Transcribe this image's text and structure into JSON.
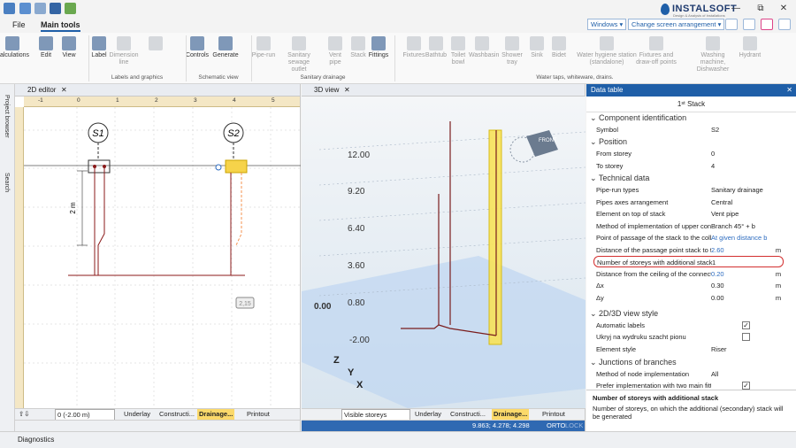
{
  "titlebar": {
    "brand": "INSTALSOFT",
    "brand_sub": "Design & Analysis of Installations",
    "min": "—",
    "restore": "⧉",
    "close": "✕"
  },
  "menu": {
    "file": "File",
    "main_tools": "Main tools",
    "windows": "Windows",
    "screen_arrangement": "Change screen arrangement"
  },
  "ribbon": {
    "buttons": [
      {
        "label": "Calculations",
        "dis": false
      },
      {
        "label": "Edit",
        "dis": false
      },
      {
        "label": "View",
        "dis": false
      },
      {
        "label": "Label",
        "dis": false
      },
      {
        "label": "Dimension line",
        "dis": true
      },
      {
        "label": "",
        "dis": true
      },
      {
        "label": "Controls",
        "dis": false
      },
      {
        "label": "Generate",
        "dis": false
      },
      {
        "label": "Pipe-run",
        "dis": true
      },
      {
        "label": "Sanitary sewage outlet",
        "dis": true
      },
      {
        "label": "Vent pipe",
        "dis": true
      },
      {
        "label": "Stack",
        "dis": true
      },
      {
        "label": "Fittings",
        "dis": false
      },
      {
        "label": "Fixtures",
        "dis": true
      },
      {
        "label": "Bathtub",
        "dis": true
      },
      {
        "label": "Toilet bowl",
        "dis": true
      },
      {
        "label": "Washbasin",
        "dis": true
      },
      {
        "label": "Shower tray",
        "dis": true
      },
      {
        "label": "Sink",
        "dis": true
      },
      {
        "label": "Bidet",
        "dis": true
      },
      {
        "label": "Water hygiene station (standalone)",
        "dis": true
      },
      {
        "label": "Fixtures and draw-off points",
        "dis": true
      },
      {
        "label": "Washing machine, Dishwasher",
        "dis": true
      },
      {
        "label": "Hydrant",
        "dis": true
      }
    ],
    "groups": {
      "labels": "Labels and graphics",
      "schematic": "Schematic view",
      "sanitary": "Sanitary drainage",
      "water": "Water taps, whiteware, drains."
    }
  },
  "left_strip": {
    "project_browser": "Project browser",
    "search": "Search"
  },
  "editor2d": {
    "title": "2D editor",
    "ruler": [
      "-1",
      "0",
      "1",
      "2",
      "3",
      "4",
      "5"
    ],
    "s1": "S1",
    "s2": "S2",
    "dim": "2 m",
    "badge": "2,15",
    "status": {
      "storey": "0 (-2.00 m)",
      "underlay": "Underlay",
      "constr": "Constructi...",
      "drainage": "Drainage...",
      "printout": "Printout"
    }
  },
  "view3d": {
    "title": "3D view",
    "levels": [
      "12.00",
      "9.20",
      "6.40",
      "3.60",
      "0.80",
      "0.00",
      "-2.00"
    ],
    "cube": "FRONT",
    "axes": {
      "z": "Z",
      "y": "Y",
      "x": "X"
    },
    "status": {
      "storeys": "Visible storeys",
      "underlay": "Underlay",
      "constr": "Constructi...",
      "drainage": "Drainage...",
      "printout": "Printout"
    },
    "coords": "9.863; 4.278; 4.298",
    "ortho": "ORTO",
    "lock": "LOCK"
  },
  "datatable": {
    "title": "Data table",
    "caption": "1ˢᵗ Stack",
    "sections": {
      "id": "Component identification",
      "pos": "Position",
      "tech": "Technical data",
      "style": "2D/3D view style",
      "junc": "Junctions of branches"
    },
    "rows": [
      {
        "label": "Symbol",
        "value": "S2",
        "unit": ""
      },
      {
        "label": "From storey",
        "value": "0",
        "unit": ""
      },
      {
        "label": "To storey",
        "value": "4",
        "unit": ""
      },
      {
        "label": "Pipe-run types",
        "value": "Sanitary drainage",
        "unit": ""
      },
      {
        "label": "Pipes axes arrangement",
        "value": "Central",
        "unit": ""
      },
      {
        "label": "Element on top of stack",
        "value": "Vent pipe",
        "unit": ""
      },
      {
        "label": "Method of implementation of upper conn",
        "value": "Branch 45° + b",
        "unit": ""
      },
      {
        "label": "Point of passage of the stack to the collec",
        "value": "At given distance b",
        "unit": ""
      },
      {
        "label": "Distance of the passage point stack to the",
        "value": "2.60",
        "unit": "m"
      },
      {
        "label": "Number of storeys with additional stack",
        "value": "1",
        "unit": ""
      },
      {
        "label": "Distance from the ceiling of the connectio",
        "value": "0.20",
        "unit": "m"
      },
      {
        "label": "Δx",
        "value": "0.30",
        "unit": "m"
      },
      {
        "label": "Δy",
        "value": "0.00",
        "unit": "m"
      },
      {
        "label": "Automatic labels",
        "value": "",
        "unit": ""
      },
      {
        "label": "Ukryj na wydruku szacht pionu",
        "value": "",
        "unit": ""
      },
      {
        "label": "Element style",
        "value": "Riser",
        "unit": ""
      },
      {
        "label": "Method of node implementation",
        "value": "All",
        "unit": ""
      },
      {
        "label": "Prefer implementation with two main fitt",
        "value": "",
        "unit": ""
      }
    ],
    "desc_title": "Number of storeys with additional stack",
    "desc_text": "Number of storeys, on which the additional (secondary) stack will be generated"
  },
  "diagnostics": "Diagnostics"
}
